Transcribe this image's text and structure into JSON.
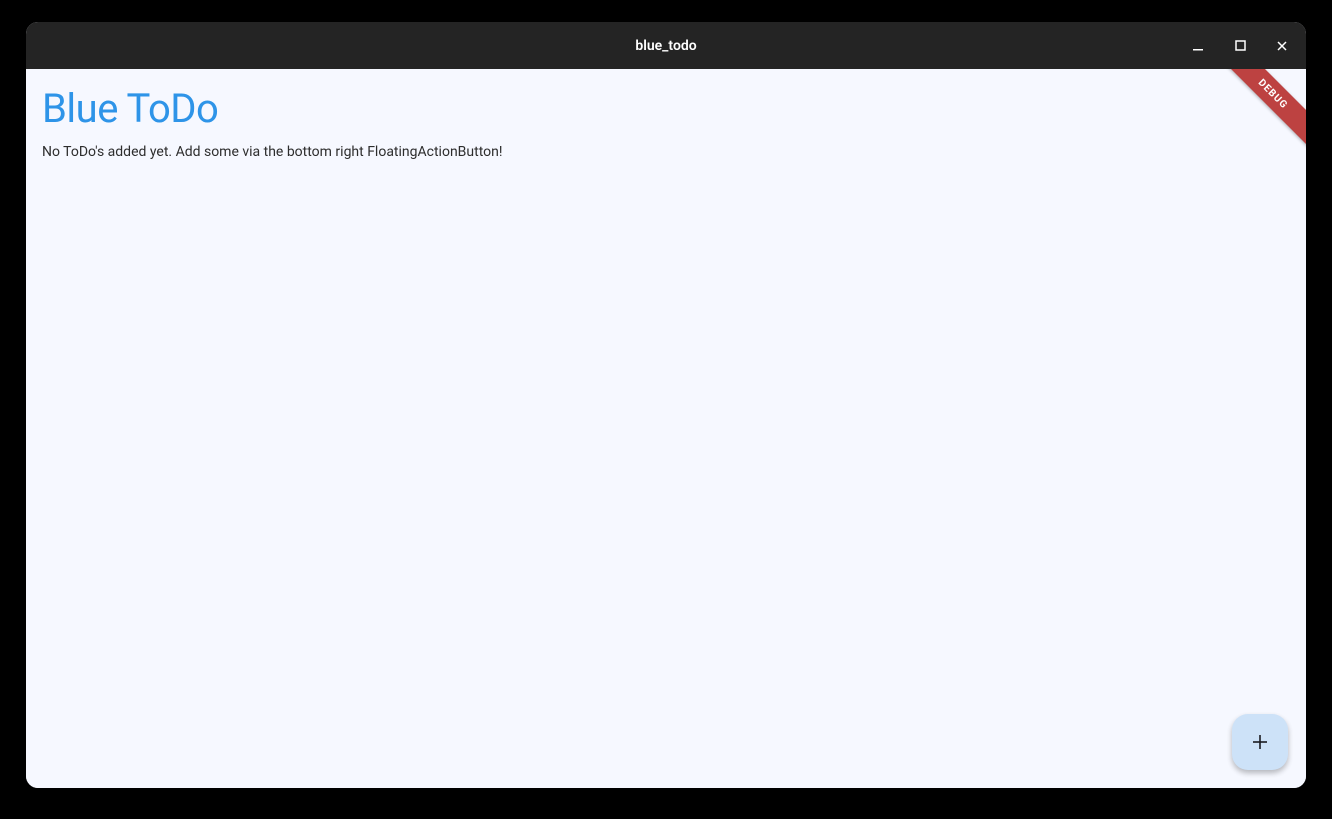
{
  "window": {
    "title": "blue_todo"
  },
  "app": {
    "title": "Blue ToDo",
    "empty_message": "No ToDo's added yet. Add some via the bottom right FloatingActionButton!"
  },
  "debug": {
    "label": "DEBUG"
  },
  "colors": {
    "accent": "#2e94e8",
    "fab_bg": "#cde2f8",
    "body_bg": "#f6f8ff",
    "debug_banner": "#bd4241"
  }
}
